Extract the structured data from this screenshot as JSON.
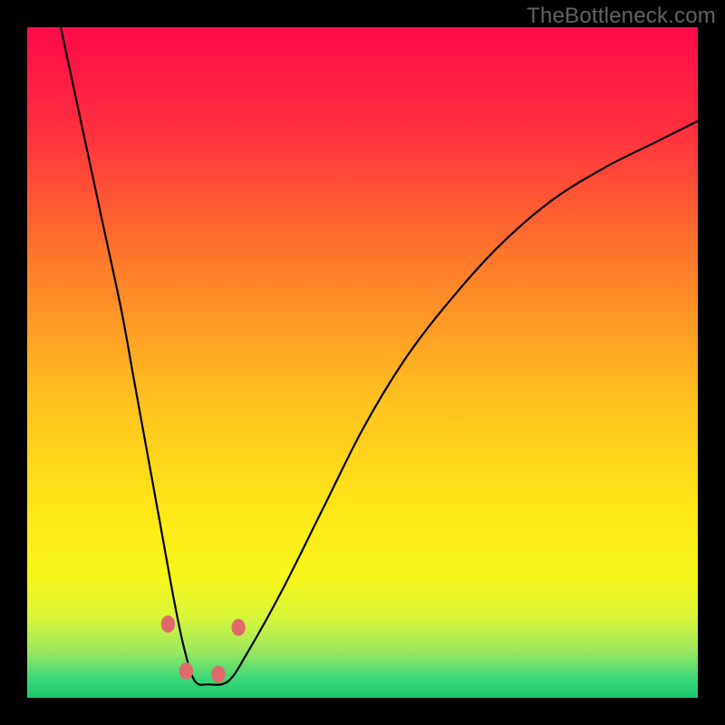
{
  "watermark": "TheBottleneck.com",
  "chart_data": {
    "type": "line",
    "title": "",
    "xlabel": "",
    "ylabel": "",
    "xlim": [
      0,
      100
    ],
    "ylim": [
      0,
      100
    ],
    "background_gradient": [
      {
        "pos": 0.0,
        "color": "#ff0a4a"
      },
      {
        "pos": 0.15,
        "color": "#ff2f3f"
      },
      {
        "pos": 0.35,
        "color": "#ff7a2a"
      },
      {
        "pos": 0.55,
        "color": "#ffc020"
      },
      {
        "pos": 0.72,
        "color": "#ffe718"
      },
      {
        "pos": 0.82,
        "color": "#f6f61a"
      },
      {
        "pos": 0.88,
        "color": "#d8f53a"
      },
      {
        "pos": 0.93,
        "color": "#9de85f"
      },
      {
        "pos": 0.97,
        "color": "#3fd979"
      },
      {
        "pos": 1.0,
        "color": "#18c96d"
      }
    ],
    "series": [
      {
        "name": "curve",
        "x": [
          5,
          8,
          11,
          14,
          16,
          18,
          20,
          22,
          23.5,
          25,
          27,
          30,
          33,
          38,
          44,
          50,
          56,
          62,
          70,
          78,
          86,
          94,
          100
        ],
        "values": [
          100,
          86,
          72,
          58,
          47,
          36,
          25,
          14,
          7,
          2.5,
          2,
          2.5,
          7,
          16,
          28,
          40,
          50,
          58,
          67,
          74,
          79,
          83,
          86
        ]
      }
    ],
    "markers": {
      "name": "anchor-dots",
      "color": "#e06a6a",
      "radius_px": 9,
      "points": [
        {
          "x": 21.0,
          "y": 11.0
        },
        {
          "x": 23.7,
          "y": 4.0
        },
        {
          "x": 28.5,
          "y": 3.5
        },
        {
          "x": 31.5,
          "y": 10.5
        }
      ]
    },
    "green_band": {
      "y0": 0,
      "y1": 5
    }
  }
}
